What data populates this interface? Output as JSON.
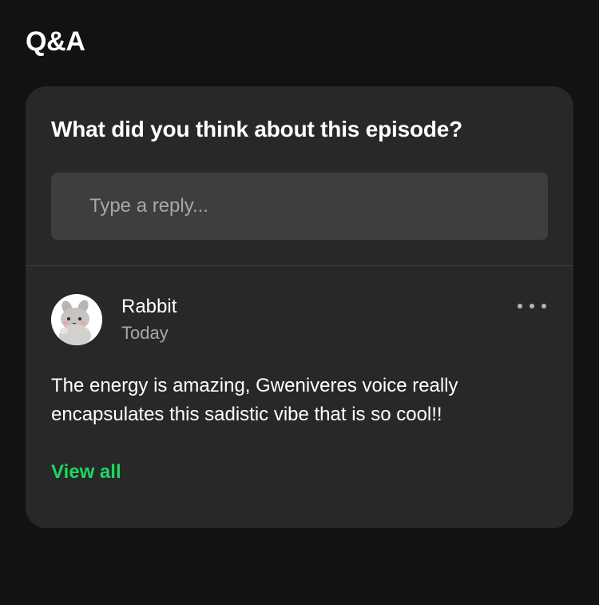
{
  "section": {
    "title": "Q&A"
  },
  "card": {
    "question": "What did you think about this episode?",
    "reply": {
      "placeholder": "Type a reply...",
      "value": ""
    },
    "comment": {
      "username": "Rabbit",
      "timestamp": "Today",
      "text": "The energy is amazing, Gweniveres voice really encapsulates this sadistic vibe that is so cool!!",
      "avatar_icon": "rabbit-avatar",
      "more_icon": "more-options-icon"
    },
    "view_all_label": "View all"
  },
  "colors": {
    "background": "#121212",
    "card": "#282828",
    "input": "#3e3e3e",
    "accent": "#1ed760",
    "muted_text": "#a7a7a7"
  }
}
